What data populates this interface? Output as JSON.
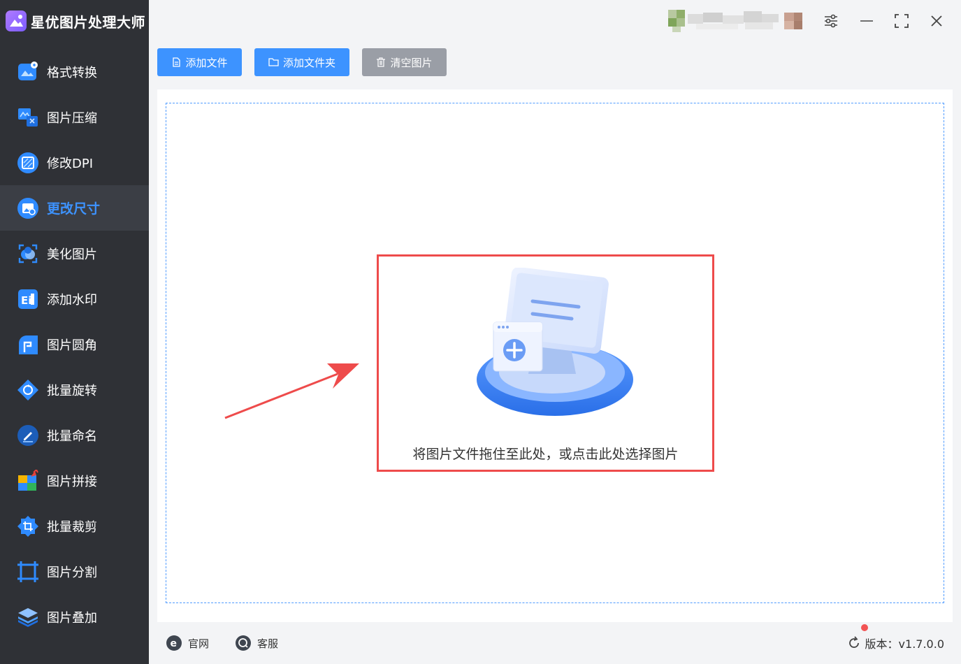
{
  "app": {
    "title": "星优图片处理大师"
  },
  "sidebar": {
    "items": [
      {
        "label": "格式转换",
        "icon": "format-convert-icon"
      },
      {
        "label": "图片压缩",
        "icon": "compress-icon"
      },
      {
        "label": "修改DPI",
        "icon": "dpi-icon"
      },
      {
        "label": "更改尺寸",
        "icon": "resize-icon",
        "active": true
      },
      {
        "label": "美化图片",
        "icon": "beautify-icon"
      },
      {
        "label": "添加水印",
        "icon": "watermark-icon"
      },
      {
        "label": "图片圆角",
        "icon": "rounded-corner-icon"
      },
      {
        "label": "批量旋转",
        "icon": "rotate-icon"
      },
      {
        "label": "批量命名",
        "icon": "rename-icon"
      },
      {
        "label": "图片拼接",
        "icon": "splice-icon"
      },
      {
        "label": "批量裁剪",
        "icon": "crop-icon"
      },
      {
        "label": "图片分割",
        "icon": "split-icon"
      },
      {
        "label": "图片叠加",
        "icon": "overlay-icon"
      }
    ]
  },
  "toolbar": {
    "add_file": "添加文件",
    "add_folder": "添加文件夹",
    "clear_images": "清空图片"
  },
  "dropzone": {
    "text": "将图片文件拖住至此处，或点击此处选择图片"
  },
  "footer": {
    "website": "官网",
    "support": "客服",
    "version": "版本：v1.7.0.0"
  },
  "colors": {
    "accent": "#3d93ff",
    "sidebar_bg": "#2f3136",
    "highlight_border": "#ee4b4b",
    "arrow": "#ee4b4b",
    "clear_button": "#9a9ea6"
  }
}
